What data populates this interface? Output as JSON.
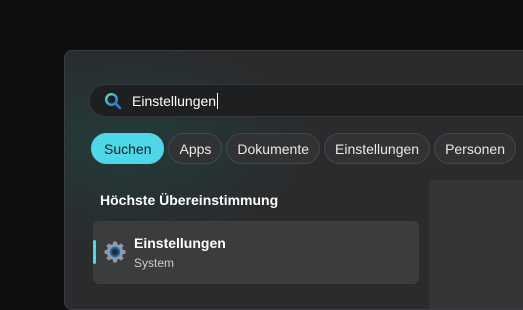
{
  "search": {
    "query": "Einstellungen",
    "icon": "search-icon"
  },
  "filters": [
    {
      "label": "Suchen",
      "active": true
    },
    {
      "label": "Apps",
      "active": false
    },
    {
      "label": "Dokumente",
      "active": false
    },
    {
      "label": "Einstellungen",
      "active": false
    },
    {
      "label": "Personen",
      "active": false
    }
  ],
  "best_match": {
    "title": "Höchste Übereinstimmung",
    "item": {
      "name": "Einstellungen",
      "type": "System",
      "icon": "gear-icon"
    }
  },
  "colors": {
    "accent": "#4ed6e9",
    "panel": "#2a2b2d",
    "background": "#0f0f10"
  }
}
